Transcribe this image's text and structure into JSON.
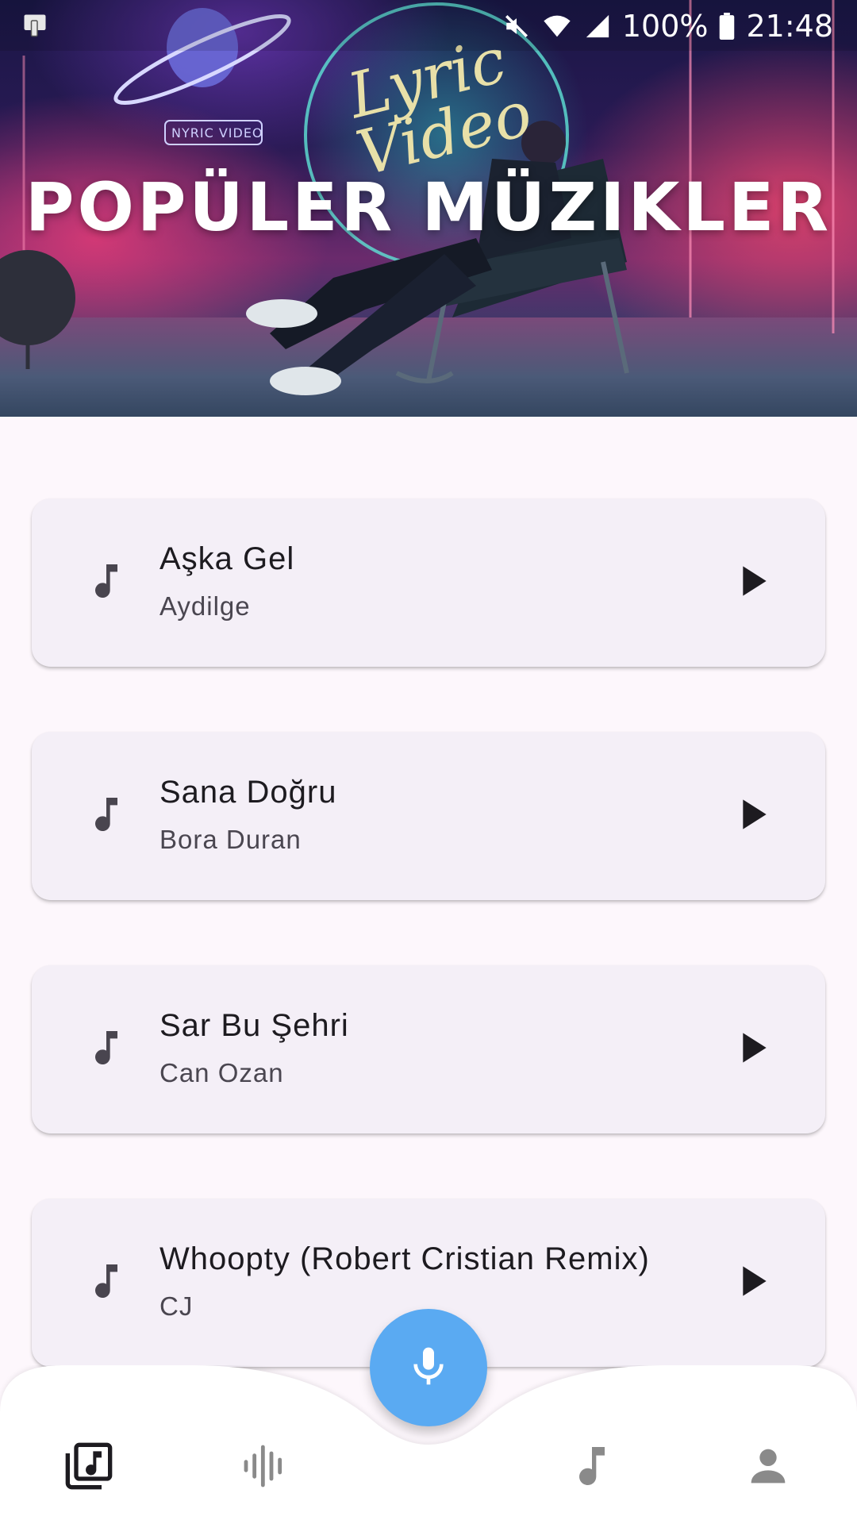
{
  "status_bar": {
    "battery": "100%",
    "time": "21:48"
  },
  "hero": {
    "title": "POPÜLER MÜZIKLER",
    "art_text_lyric": "Lyric",
    "art_text_video": "Video",
    "art_badge": "NYRIC VIDEO"
  },
  "songs": [
    {
      "title": "Aşka Gel",
      "artist": "Aydilge"
    },
    {
      "title": "Sana Doğru",
      "artist": "Bora Duran"
    },
    {
      "title": "Sar Bu Şehri",
      "artist": "Can Ozan"
    },
    {
      "title": "Whoopty (Robert Cristian Remix)",
      "artist": "CJ"
    }
  ],
  "icons": {
    "song": "music-note-icon",
    "play": "play-icon",
    "fab": "microphone-icon",
    "nav": [
      "music-library-icon",
      "waveform-icon",
      "music-note-icon",
      "person-icon"
    ]
  },
  "colors": {
    "background": "#fdf7fc",
    "card": "#f4eff7",
    "fab": "#5aaaf2",
    "nav_active": "#1d1b20",
    "nav_inactive": "#8a8a8a"
  },
  "bottom_nav": {
    "active_index": 0
  }
}
